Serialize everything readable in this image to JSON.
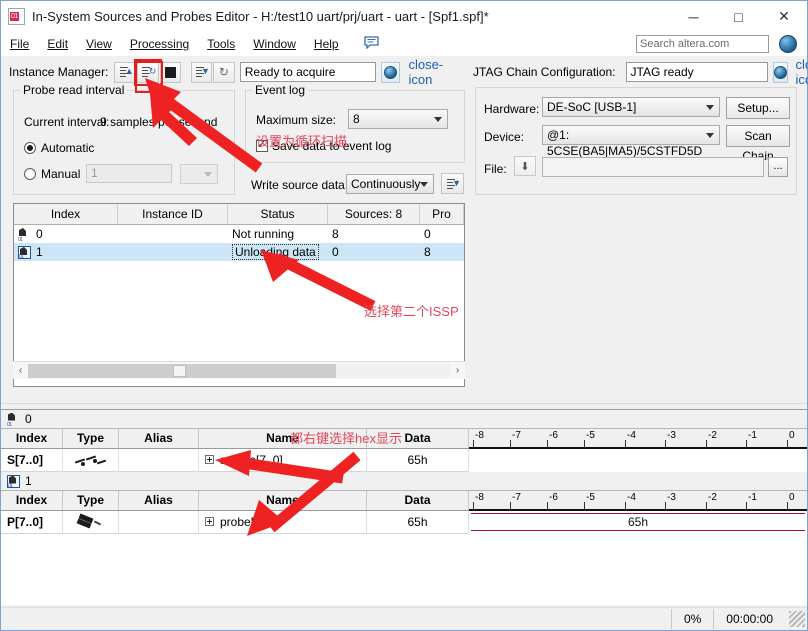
{
  "window": {
    "title": "In-System Sources and Probes Editor - H:/test10 uart/prj/uart - uart - [Spf1.spf]*",
    "app_icon": "issp-icon",
    "minimize": "─",
    "maximize": "□",
    "close": "✕"
  },
  "menu": {
    "items": [
      {
        "label": "File"
      },
      {
        "label": "Edit"
      },
      {
        "label": "View"
      },
      {
        "label": "Processing"
      },
      {
        "label": "Tools"
      },
      {
        "label": "Window"
      },
      {
        "label": "Help"
      }
    ],
    "comment_icon": "speech-bubble-icon",
    "search": {
      "placeholder": "Search altera.com",
      "value": ""
    },
    "globe_icon": "globe-icon"
  },
  "instance_manager": {
    "label": "Instance Manager:",
    "buttons": [
      {
        "name": "run-analysis-button",
        "icon": "list-up-icon"
      },
      {
        "name": "continuous-analysis-button",
        "icon": "list-refresh-icon",
        "highlighted": true
      },
      {
        "name": "stop-analysis-button",
        "icon": "stop-square-icon"
      },
      {
        "name": "read-probe-data-button",
        "icon": "list-down-icon"
      },
      {
        "name": "refresh-button",
        "icon": "refresh-icon"
      }
    ],
    "status": "Ready to acquire",
    "help_icon": "globe-help-icon",
    "close_icon": "close-icon",
    "probe_read_interval": {
      "legend": "Probe read interval",
      "current_interval_label": "Current interval:",
      "current_interval_value": "9 samples per second",
      "automatic_label": "Automatic",
      "automatic_selected": true,
      "manual_label": "Manual",
      "manual_selected": false,
      "manual_value": "1"
    },
    "event_log": {
      "legend": "Event log",
      "maximum_size_label": "Maximum size:",
      "maximum_size_value": "8",
      "save_data_label": "Save data to event log",
      "save_data_checked": true
    },
    "write_source_data": {
      "label": "Write source data:",
      "value": "Continuously",
      "button_icon": "list-down-icon"
    },
    "table": {
      "columns": [
        "Index",
        "Instance ID",
        "Status",
        "Sources: 8",
        "Pro"
      ],
      "rows": [
        {
          "index": "0",
          "instance_id": "",
          "status": "Not running",
          "sources": "8",
          "probes": "0",
          "selected": false
        },
        {
          "index": "1",
          "instance_id": "",
          "status": "Unloading data",
          "sources": "0",
          "probes": "8",
          "selected": true
        }
      ]
    },
    "scrollbar": {
      "left_arrow": "‹",
      "right_arrow": "›"
    }
  },
  "jtag": {
    "label": "JTAG Chain Configuration:",
    "status": "JTAG ready",
    "help_icon": "globe-help-icon",
    "close_icon": "close-icon",
    "hardware_label": "Hardware:",
    "hardware_value": "DE-SoC [USB-1]",
    "setup_button": "Setup...",
    "device_label": "Device:",
    "device_value": "@1: 5CSE(BA5|MA5)/5CSTFD5D",
    "scan_chain_button": "Scan Chain",
    "file_label": "File:",
    "file_icon": "download-file-icon",
    "file_value": "",
    "browse_button": "..."
  },
  "bottom": {
    "groups": [
      {
        "instance_label": "0",
        "instance_icon": "instance-icon",
        "instance_selected": false,
        "columns": [
          "Index",
          "Type",
          "Alias",
          "Name",
          "Data"
        ],
        "row": {
          "index": "S[7..0]",
          "type_icon": "source-glyph-icon",
          "alias": "",
          "name": "source[7..0]",
          "data": "65h",
          "wave_value": ""
        }
      },
      {
        "instance_label": "1",
        "instance_icon": "instance-icon",
        "instance_selected": true,
        "columns": [
          "Index",
          "Type",
          "Alias",
          "Name",
          "Data"
        ],
        "row": {
          "index": "P[7..0]",
          "type_icon": "probe-glyph-icon",
          "alias": "",
          "name": "probe[7..0]",
          "data": "65h",
          "wave_value": "65h"
        }
      }
    ],
    "ruler_ticks": [
      "-8",
      "-7",
      "-6",
      "-5",
      "-4",
      "-3",
      "-2",
      "-1",
      "0"
    ]
  },
  "statusbar": {
    "progress": "0%",
    "time": "00:00:00"
  },
  "annotations": [
    {
      "name": "annotation-loop-scan",
      "text": "设置为循环扫描"
    },
    {
      "name": "annotation-select-second-issp",
      "text": "选择第二个ISSP"
    },
    {
      "name": "annotation-right-click-hex",
      "text": "都右键选择hex显示"
    }
  ],
  "colors": {
    "annotation_red": "#e0485c",
    "highlight_red": "#e02020",
    "selection_blue": "#cde6f7",
    "wave_red": "#a11030"
  }
}
